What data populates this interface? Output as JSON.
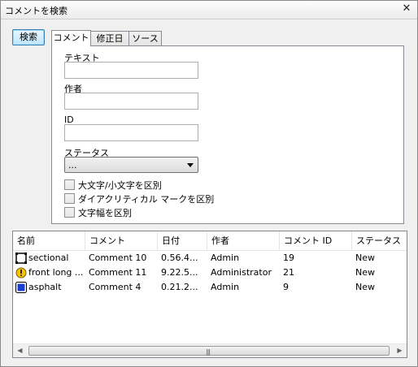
{
  "window": {
    "title": "コメントを検索",
    "close_glyph": "✕"
  },
  "search_button": {
    "label": "検索"
  },
  "tabs": [
    {
      "label": "コメント",
      "active": true
    },
    {
      "label": "修正日",
      "active": false
    },
    {
      "label": "ソース",
      "active": false
    }
  ],
  "form": {
    "text_label": "テキスト",
    "text_value": "",
    "author_label": "作者",
    "author_value": "",
    "id_label": "ID",
    "id_value": "",
    "status_label": "ステータス",
    "status_selected": "...",
    "checkboxes": [
      {
        "label": "大文字/小文字を区別",
        "checked": false
      },
      {
        "label": "ダイアクリティカル マークを区別",
        "checked": false
      },
      {
        "label": "文字幅を区別",
        "checked": false
      }
    ]
  },
  "results": {
    "columns": [
      "名前",
      "コメント",
      "日付",
      "作者",
      "コメント ID",
      "ステータス"
    ],
    "rows": [
      {
        "icon": "film-frame-icon",
        "name": "sectional",
        "comment": "Comment 10",
        "date": "0.56.4...",
        "author": "Admin",
        "id": "19",
        "status": "New"
      },
      {
        "icon": "warning-circle-icon",
        "name": "front long ...",
        "comment": "Comment 11",
        "date": "9.22.5...",
        "author": "Administrator",
        "id": "21",
        "status": "New"
      },
      {
        "icon": "blue-square-icon",
        "name": "asphalt",
        "comment": "Comment 4",
        "date": "0.21.2...",
        "author": "Admin",
        "id": "9",
        "status": "New"
      }
    ]
  },
  "colors": {
    "accent_border": "#3c7fb1",
    "warning_yellow": "#f5c400",
    "icon_blue": "#1a3fd0"
  }
}
